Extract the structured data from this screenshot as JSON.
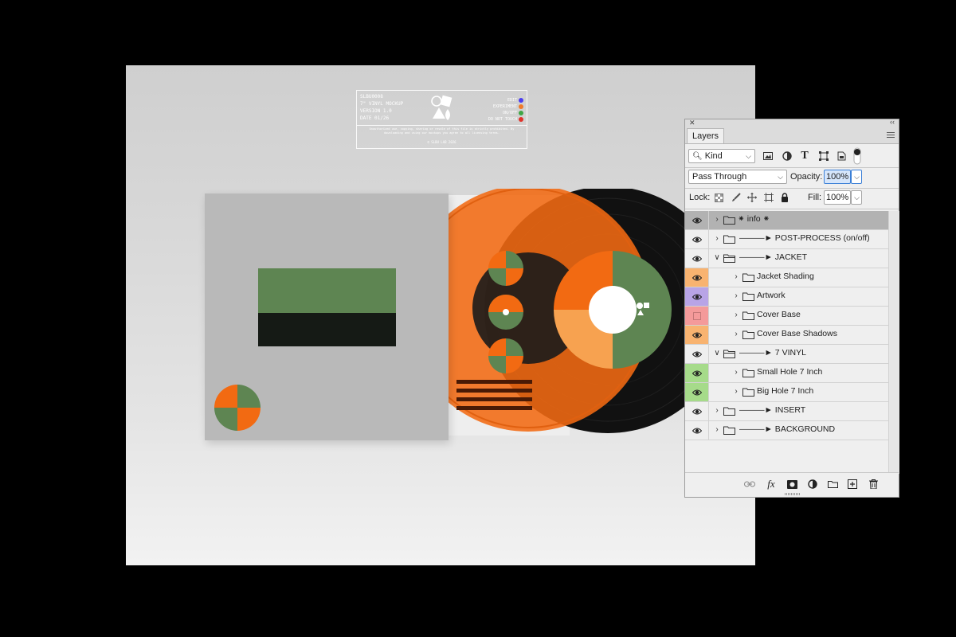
{
  "mockup": {
    "label_meta": "SLBU0008\n7\" VINYL MOCKUP\nVERSION 1.0\nDATE 01/26",
    "legend": [
      {
        "text": "EDIT",
        "color": "#4b3df0"
      },
      {
        "text": "EXPERIMENT",
        "color": "#f07a2a"
      },
      {
        "text": "ON/OFF",
        "color": "#3fa545"
      },
      {
        "text": "DO NOT TOUCH",
        "color": "#e0322a"
      }
    ],
    "notice": "Unauthorized use, copying, sharing or resale of this file is strictly prohibited. By downloading and using our mockups you agree to all licensing terms.",
    "copyright": "© SLBU LAB 2026",
    "colors": {
      "green": "#5e8552",
      "dark": "#151a15",
      "orange": "#f26a12",
      "vinyl": "#111111",
      "sleeve": "#b9b9b9"
    }
  },
  "panel": {
    "close_glyph": "✕",
    "collapse_glyph": "‹‹",
    "tab": "Layers",
    "filter_kind": "Kind",
    "blend_mode": "Pass Through",
    "opacity_label": "Opacity:",
    "opacity_value": "100%",
    "lock_label": "Lock:",
    "fill_label": "Fill:",
    "fill_value": "100%",
    "layers": [
      {
        "name": "⁕ info ⁕",
        "indent": 0,
        "expanded": false,
        "selected": true,
        "eye": true,
        "color": ""
      },
      {
        "name": "———► POST-PROCESS (on/off)",
        "indent": 0,
        "expanded": false,
        "selected": false,
        "eye": true,
        "color": ""
      },
      {
        "name": "———► JACKET",
        "indent": 0,
        "expanded": true,
        "selected": false,
        "eye": true,
        "color": ""
      },
      {
        "name": "Jacket Shading",
        "indent": 1,
        "expanded": false,
        "selected": false,
        "eye": true,
        "color": "#f8b370"
      },
      {
        "name": "Artwork",
        "indent": 1,
        "expanded": false,
        "selected": false,
        "eye": true,
        "color": "#b8a4e6"
      },
      {
        "name": "Cover Base",
        "indent": 1,
        "expanded": false,
        "selected": false,
        "eye": false,
        "color": "#f49a9a"
      },
      {
        "name": "Cover Base Shadows",
        "indent": 1,
        "expanded": false,
        "selected": false,
        "eye": true,
        "color": "#f8b370"
      },
      {
        "name": "———► 7 VINYL",
        "indent": 0,
        "expanded": true,
        "selected": false,
        "eye": true,
        "color": ""
      },
      {
        "name": "Small Hole 7 Inch",
        "indent": 1,
        "expanded": false,
        "selected": false,
        "eye": true,
        "color": "#a6db8a"
      },
      {
        "name": "Big Hole 7 Inch",
        "indent": 1,
        "expanded": false,
        "selected": false,
        "eye": true,
        "color": "#a6db8a"
      },
      {
        "name": "———► INSERT",
        "indent": 0,
        "expanded": false,
        "selected": false,
        "eye": true,
        "color": ""
      },
      {
        "name": "———► BACKGROUND",
        "indent": 0,
        "expanded": false,
        "selected": false,
        "eye": true,
        "color": ""
      }
    ]
  }
}
